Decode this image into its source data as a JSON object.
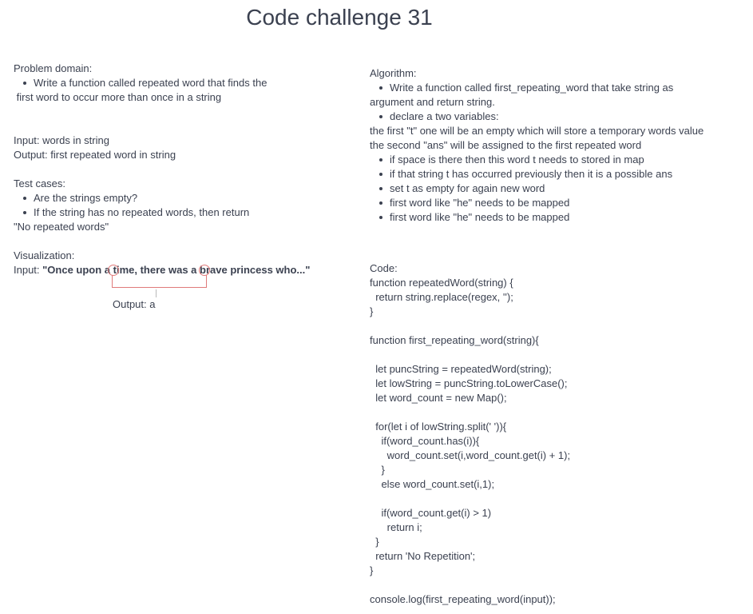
{
  "title": "Code challenge 31",
  "problem": {
    "heading": "Problem domain:",
    "bullet_line1": "Write a function called repeated word that finds the",
    "bullet_line2": " first word to occur more than once in a string"
  },
  "io": {
    "input": "Input: words in string",
    "output": "Output: first repeated word in string"
  },
  "tests": {
    "heading": "Test cases:",
    "case1": "Are the strings empty?",
    "case2_line1": "If the string has no repeated words, then return",
    "case2_line2": "\"No repeated words\""
  },
  "visualization": {
    "heading": "Visualization:",
    "input_label": "Input: ",
    "sentence": "\"Once upon a time, there was a brave princess who...\"",
    "output": "Output: a"
  },
  "algorithm": {
    "heading": "Algorithm:",
    "b1_line1": "Write a function called first_repeating_word that take string as",
    "b1_line2": "argument and return string.",
    "b2": "declare a two variables:",
    "p1": "the first \"t\" one will be an empty which will store a temporary words value",
    "p2": "the second \"ans\" will be assigned to the first repeated word",
    "b3": "if space is there then this word t needs to stored in map",
    "b4": "if that string t has occurred previously then it is a possible ans",
    "b5": "set t as empty for again new word",
    "b6": "first word like \"he\" needs to be mapped",
    "b7": "first word like \"he\" needs to be mapped"
  },
  "code": {
    "heading": "Code:",
    "l1": "function repeatedWord(string) {",
    "l2": "  return string.replace(regex, '');",
    "l3": "}",
    "l4": "function first_repeating_word(string){",
    "l5": "  let puncString = repeatedWord(string);",
    "l6": "  let lowString = puncString.toLowerCase();",
    "l7": "  let word_count = new Map();",
    "l8": "  for(let i of lowString.split(' ')){",
    "l9": "    if(word_count.has(i)){",
    "l10": "      word_count.set(i,word_count.get(i) + 1);",
    "l11": "    }",
    "l12": "    else word_count.set(i,1);",
    "l13": "    if(word_count.get(i) > 1)",
    "l14": "      return i;",
    "l15": "  }",
    "l16": "  return 'No Repetition';",
    "l17": "}",
    "l18": "console.log(first_repeating_word(input));"
  }
}
